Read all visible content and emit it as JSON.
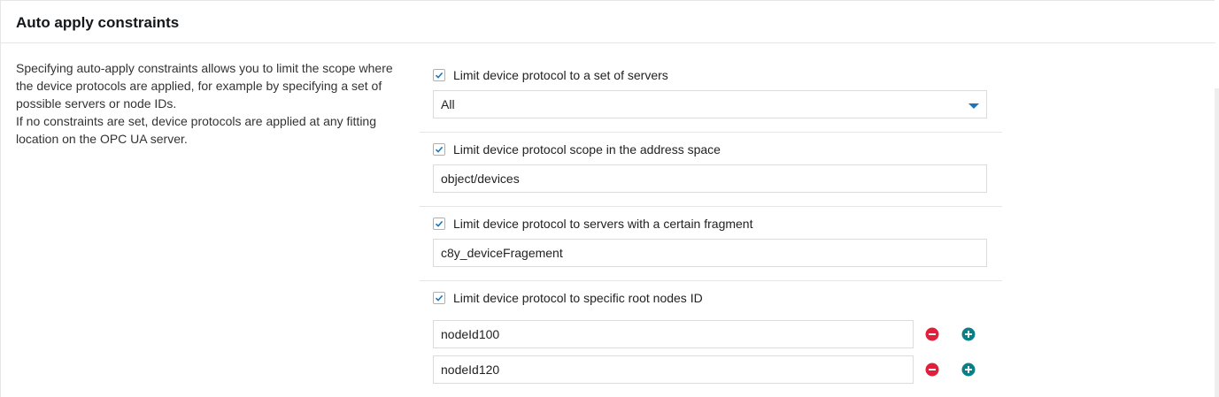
{
  "section": {
    "title": "Auto apply constraints",
    "description": [
      "Specifying auto-apply constraints allows you to limit the scope where the device protocols are applied, for example by specifying a set of possible servers or node IDs.",
      "If no constraints are set, device protocols are applied at any fitting location on the OPC UA server."
    ]
  },
  "constraints": {
    "servers": {
      "label": "Limit device protocol to a set of servers",
      "checked": true,
      "select_value": "All"
    },
    "scope": {
      "label": "Limit device protocol scope in the address space",
      "checked": true,
      "value": "object/devices"
    },
    "fragment": {
      "label": "Limit device protocol to servers with a certain fragment",
      "checked": true,
      "value": "c8y_deviceFragement"
    },
    "root_nodes": {
      "label": "Limit device protocol to specific root nodes ID",
      "checked": true,
      "values": [
        "nodeId100",
        "nodeId120"
      ]
    }
  },
  "colors": {
    "checkmark": "#1776bf",
    "remove": "#e0203a",
    "add": "#0b7f88",
    "select_arrow": "#1776bf"
  },
  "icons": {
    "checkbox": "check-icon",
    "remove": "minus-circle-icon",
    "add": "plus-circle-icon",
    "dropdown": "caret-down-icon"
  }
}
